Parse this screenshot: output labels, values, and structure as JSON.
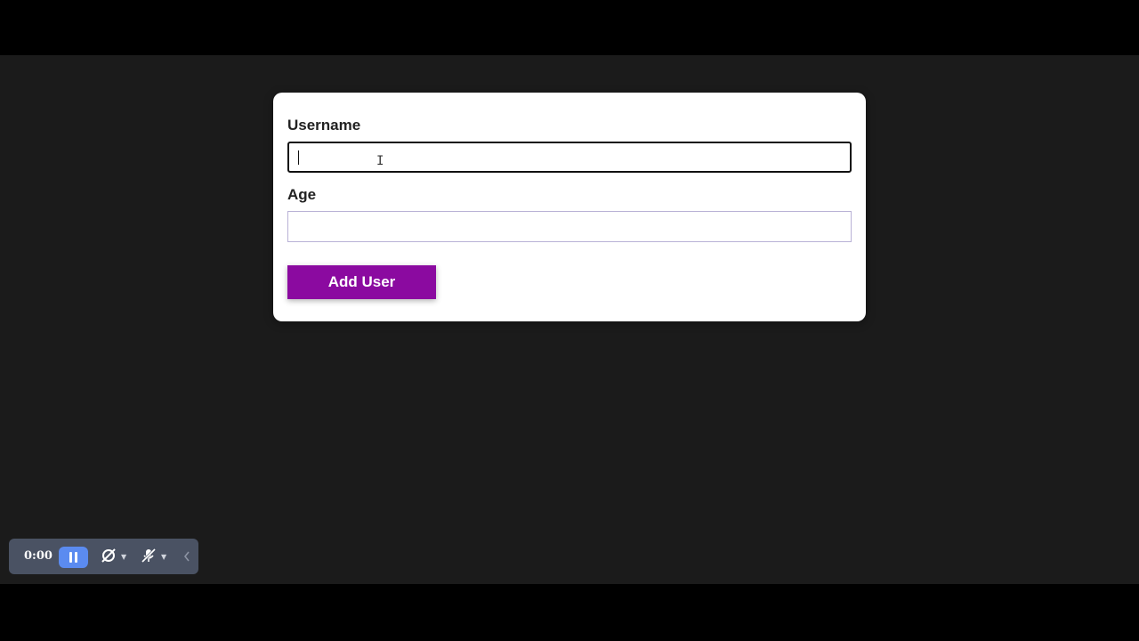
{
  "form": {
    "username_label": "Username",
    "username_value": "",
    "age_label": "Age",
    "age_value": "",
    "submit_label": "Add User"
  },
  "recorder": {
    "time": "0:00",
    "pause_icon": "pause-icon",
    "camera_icon": "camera-off-icon",
    "mic_icon": "mic-off-icon",
    "collapse_icon": "chevron-left-icon"
  },
  "colors": {
    "button": "#8b0aa0",
    "page_background": "#1b1b1b",
    "recorder_background": "#4a5263",
    "pause_accent": "#5b8bf0"
  }
}
